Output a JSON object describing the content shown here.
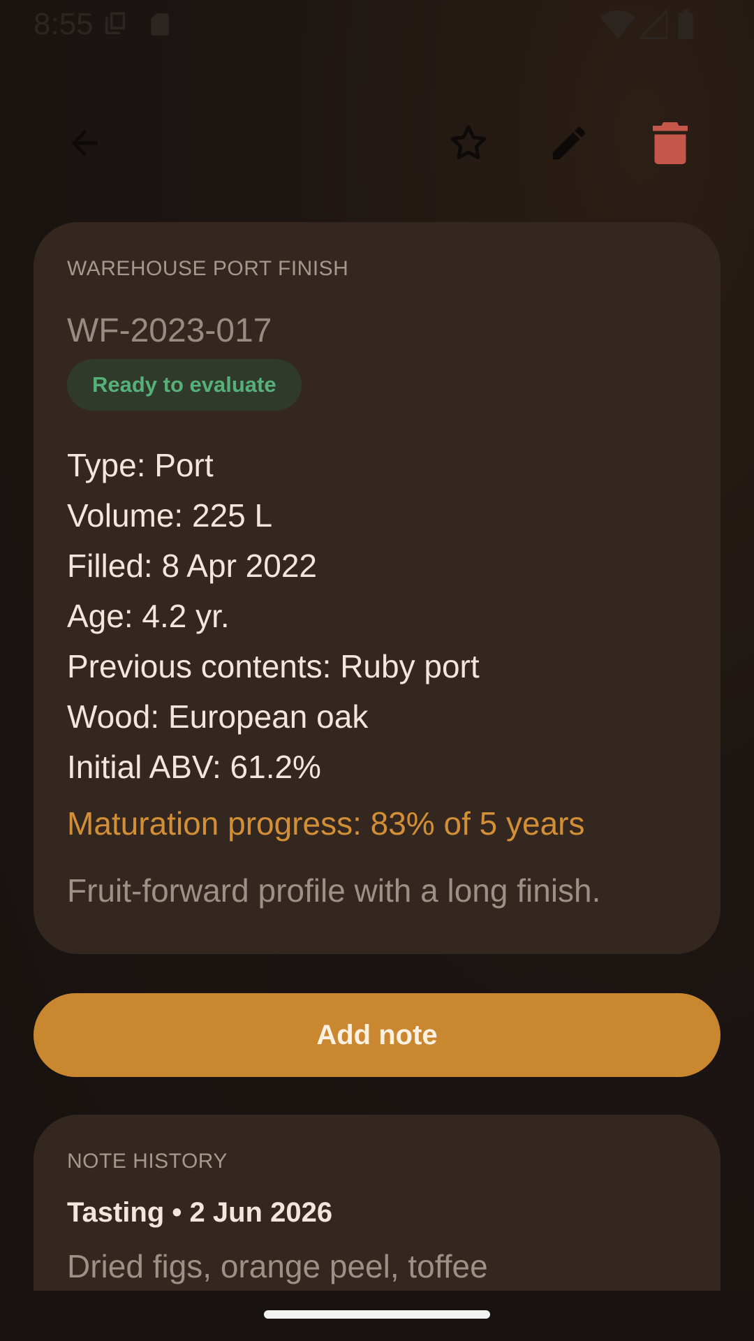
{
  "status_bar": {
    "time": "8:55",
    "icons": [
      "copy-icon",
      "sd-card-icon",
      "wifi-icon",
      "signal-icon",
      "battery-icon"
    ]
  },
  "toolbar": {
    "icons": [
      "back-arrow-icon",
      "star-outline-icon",
      "pencil-icon",
      "trash-icon"
    ],
    "delete_color": "#c4574a"
  },
  "cask": {
    "warehouse": "WAREHOUSE PORT FINISH",
    "code": "WF-2023-017",
    "status": "Ready to evaluate",
    "details": [
      "Type: Port",
      "Volume: 225 L",
      "Filled: 8 Apr 2022",
      "Age: 4.2 yr.",
      "Previous contents: Ruby port",
      "Wood: European oak",
      "Initial ABV: 61.2%"
    ],
    "progress_text": "Maturation progress: 83% of 5 years",
    "notes": "Fruit-forward profile with a long finish."
  },
  "actions": {
    "add_note_label": "Add note"
  },
  "history": {
    "header": "NOTE HISTORY",
    "entries": [
      {
        "title": "Tasting • 2 Jun 2026",
        "text": "Dried figs, orange peel, toffee"
      }
    ]
  },
  "colors": {
    "accent": "#c98730",
    "card": "#342720",
    "status_green": "#57b07a",
    "progress": "#d38f35"
  }
}
